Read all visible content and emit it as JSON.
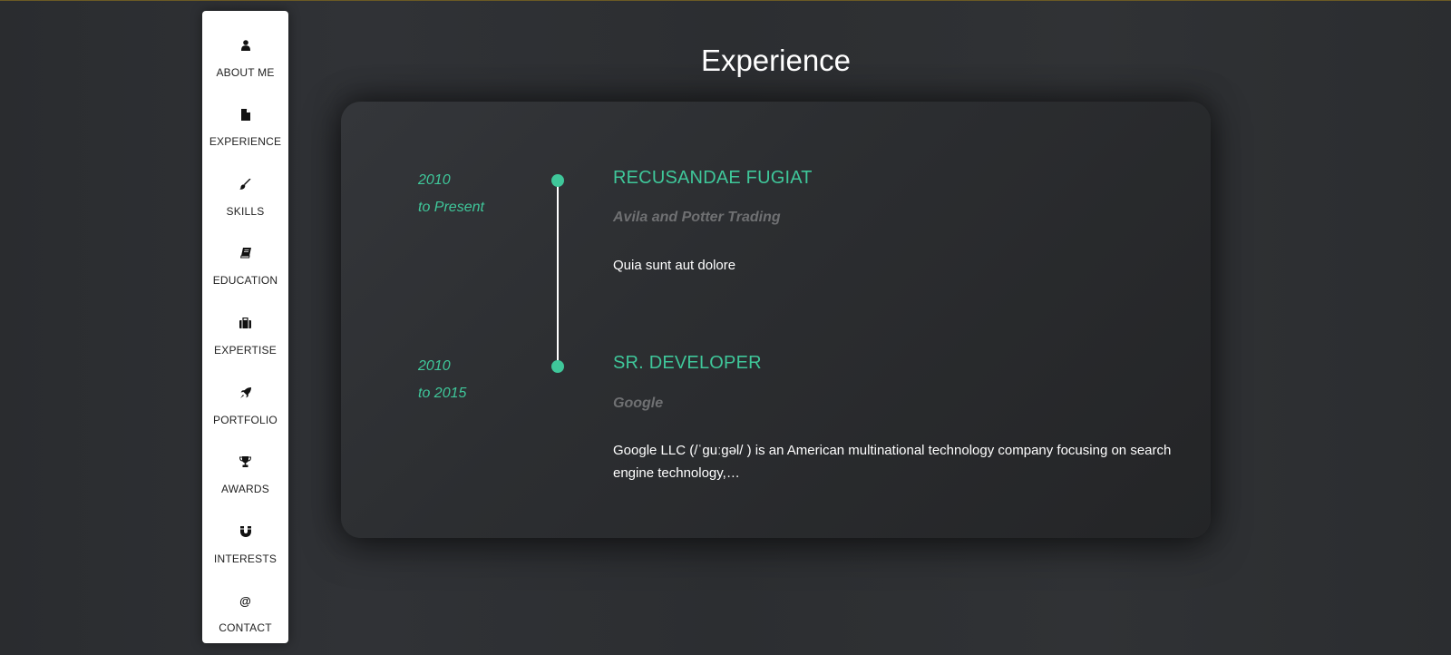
{
  "sidebar": {
    "items": [
      {
        "label": "ABOUT ME",
        "icon": "user-icon"
      },
      {
        "label": "EXPERIENCE",
        "icon": "file-icon"
      },
      {
        "label": "SKILLS",
        "icon": "paint-brush-icon"
      },
      {
        "label": "EDUCATION",
        "icon": "book-icon"
      },
      {
        "label": "EXPERTISE",
        "icon": "briefcase-icon"
      },
      {
        "label": "PORTFOLIO",
        "icon": "rocket-icon"
      },
      {
        "label": "AWARDS",
        "icon": "trophy-icon"
      },
      {
        "label": "INTERESTS",
        "icon": "magnet-icon"
      },
      {
        "label": "CONTACT",
        "icon": "at-icon"
      }
    ]
  },
  "main": {
    "title": "Experience",
    "entries": [
      {
        "date_start": "2010",
        "date_end": "to Present",
        "title": "RECUSANDAE FUGIAT",
        "company": "Avila and Potter Trading",
        "description": "Quia sunt aut dolore"
      },
      {
        "date_start": "2010",
        "date_end": "to 2015",
        "title": "SR. DEVELOPER",
        "company": "Google",
        "description": "Google LLC (/ˈɡuːɡəl/ ) is an American multinational technology company focusing on search engine technology,…"
      }
    ]
  },
  "colors": {
    "accent": "#3fc79a",
    "background": "#2e3033",
    "sidebar": "#ffffff",
    "muted": "#6f7072"
  }
}
